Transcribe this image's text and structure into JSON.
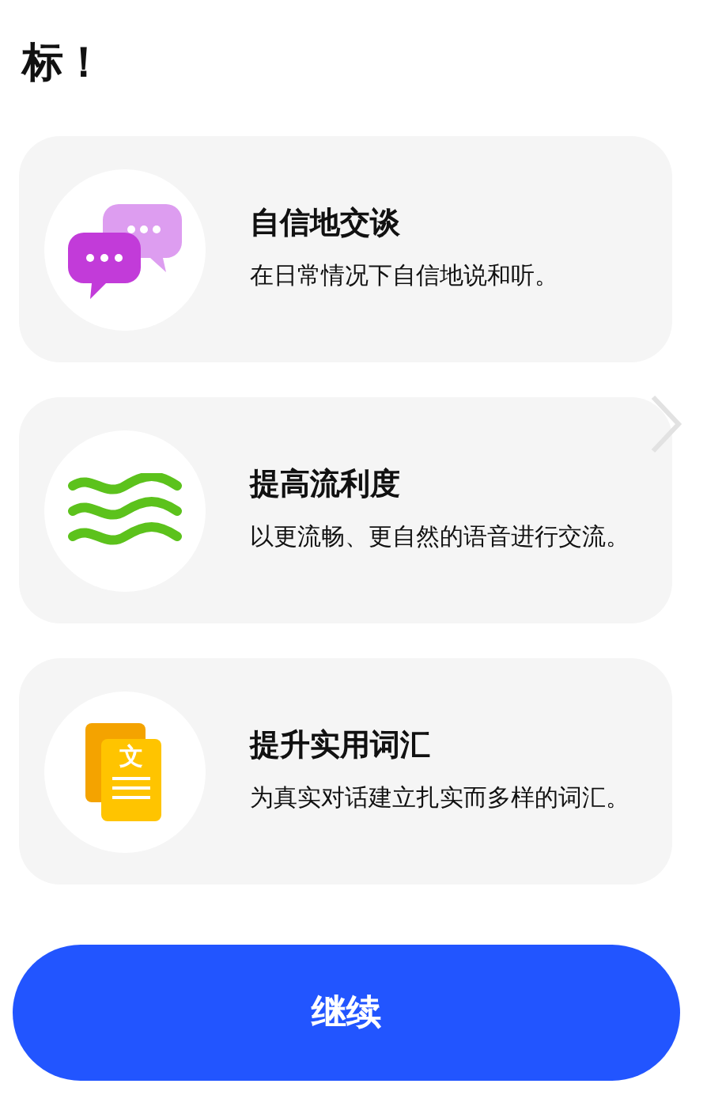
{
  "heading": "标！",
  "goals": [
    {
      "kind": "chat",
      "title": "自信地交谈",
      "description": "在日常情况下自信地说和听。"
    },
    {
      "kind": "waves",
      "title": "提高流利度",
      "description": "以更流畅、更自然的语音进行交流。"
    },
    {
      "kind": "document",
      "title": "提升实用词汇",
      "description": "为真实对话建立扎实而多样的词汇。",
      "icon_label": "文"
    }
  ],
  "button": "继续"
}
